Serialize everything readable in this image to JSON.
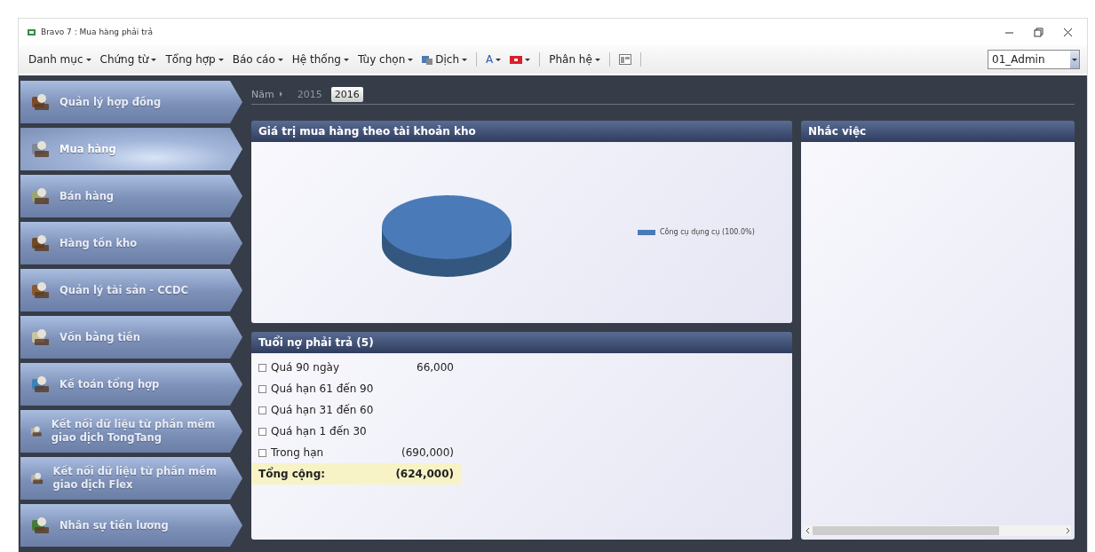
{
  "window": {
    "title": "Bravo 7 : Mua hàng phải trả"
  },
  "menu": [
    {
      "label": "Danh mục",
      "kind": "menu"
    },
    {
      "label": "Chứng từ",
      "kind": "menu"
    },
    {
      "label": "Tổng hợp",
      "kind": "menu"
    },
    {
      "label": "Báo cáo",
      "kind": "menu"
    },
    {
      "label": "Hệ thống",
      "kind": "menu"
    },
    {
      "label": "Tùy chọn",
      "kind": "menu"
    },
    {
      "label": "Dịch",
      "kind": "translate"
    },
    {
      "label": "A",
      "kind": "font"
    },
    {
      "kind": "flag"
    },
    {
      "label": "Phân hệ",
      "kind": "menu"
    },
    {
      "kind": "layout"
    }
  ],
  "user_select": {
    "value": "01_Admin"
  },
  "sidebar": {
    "items": [
      {
        "label": "Quản lý hợp đồng",
        "selected": false
      },
      {
        "label": "Mua hàng",
        "selected": true
      },
      {
        "label": "Bán hàng",
        "selected": false
      },
      {
        "label": "Hàng tồn kho",
        "selected": false
      },
      {
        "label": "Quản lý tài sản - CCDC",
        "selected": false
      },
      {
        "label": "Vốn bằng tiền",
        "selected": false
      },
      {
        "label": "Kế toán tổng hợp",
        "selected": false
      },
      {
        "label": "Kết nối dữ liệu từ phần mềm giao dịch TongTang",
        "selected": false
      },
      {
        "label": "Kết nối dữ liệu từ phần mềm giao dịch Flex",
        "selected": false
      },
      {
        "label": "Nhân sự tiền lương",
        "selected": false
      }
    ]
  },
  "year_tabs": {
    "label": "Năm",
    "tabs": [
      {
        "label": "2015",
        "selected": false
      },
      {
        "label": "2016",
        "selected": true
      }
    ]
  },
  "purchase_chart": {
    "title": "Giá trị mua hàng theo tài khoản kho",
    "chart_data": {
      "type": "pie",
      "categories": [
        "Công cụ dụng cụ (100.0%)"
      ],
      "values": [
        100
      ]
    }
  },
  "debt_panel": {
    "title": "Tuổi nợ phải trả (5)",
    "rows": [
      {
        "label": "Quá 90 ngày",
        "amount": "66,000",
        "checked": false
      },
      {
        "label": "Quá hạn 61 đến 90",
        "checked": false
      },
      {
        "label": "Quá hạn 31 đến 60",
        "checked": false
      },
      {
        "label": "Quá hạn 1 đến 30",
        "checked": false
      },
      {
        "label": "Trong hạn",
        "amount": "(690,000)",
        "checked": false
      }
    ],
    "total": {
      "label": "Tổng cộng:",
      "amount": "(624,000)"
    }
  },
  "reminder_panel": {
    "title": "Nhắc việc"
  }
}
